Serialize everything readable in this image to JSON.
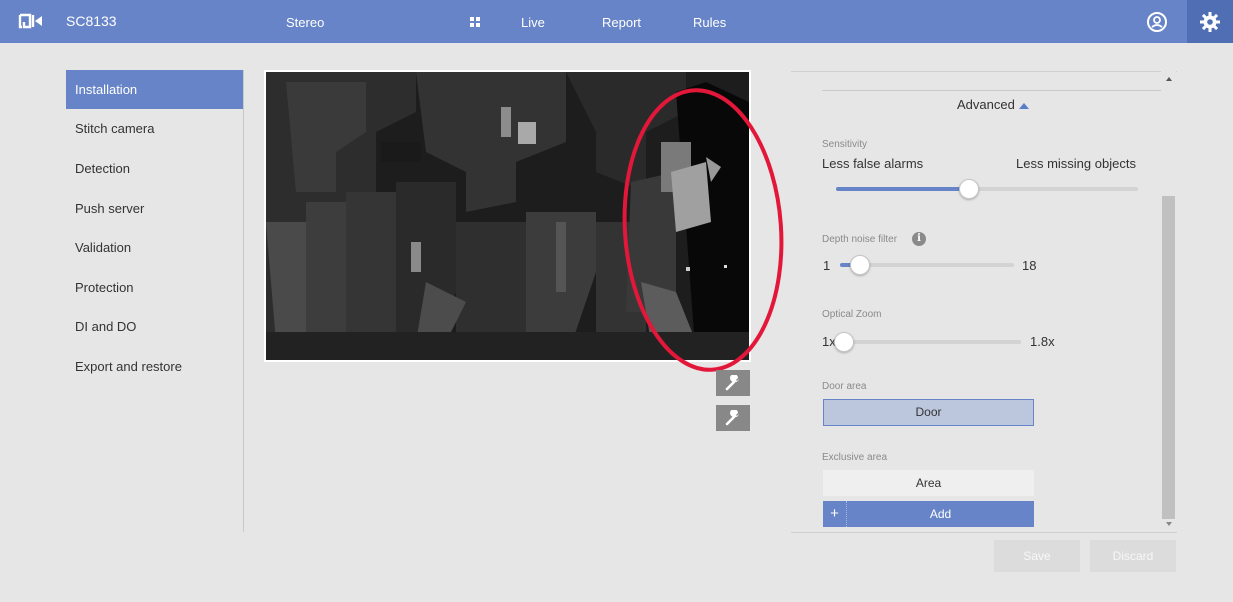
{
  "header": {
    "model": "SC8133",
    "stream": "Stereo",
    "nav": [
      "Live",
      "Report",
      "Rules"
    ],
    "logo_icon": "vivotek-logo-icon",
    "account_icon": "account-icon",
    "settings_icon": "gear-icon",
    "accent": "#6684c7"
  },
  "sidebar": {
    "items": [
      {
        "label": "Installation",
        "active": true
      },
      {
        "label": "Stitch camera"
      },
      {
        "label": "Detection"
      },
      {
        "label": "Push server"
      },
      {
        "label": "Validation"
      },
      {
        "label": "Protection"
      },
      {
        "label": "DI and DO"
      },
      {
        "label": "Export and restore"
      }
    ]
  },
  "panel": {
    "advanced_label": "Advanced",
    "sensitivity": {
      "label": "Sensitivity",
      "left_label": "Less false alarms",
      "right_label": "Less missing objects",
      "value_fraction": 0.44
    },
    "depth_noise": {
      "label": "Depth noise filter",
      "min": "1",
      "max": "18",
      "value": 3
    },
    "optical_zoom": {
      "label": "Optical Zoom",
      "min": "1x",
      "max": "1.8x",
      "value_fraction": 0.0
    },
    "door_area": {
      "label": "Door area",
      "button": "Door"
    },
    "exclusive_area": {
      "label": "Exclusive area",
      "area_button": "Area",
      "add_button": "Add",
      "add_icon": "+"
    }
  },
  "footer": {
    "save": "Save",
    "discard": "Discard"
  },
  "annotation": {
    "color": "#e3173a",
    "shape": "ellipse"
  }
}
